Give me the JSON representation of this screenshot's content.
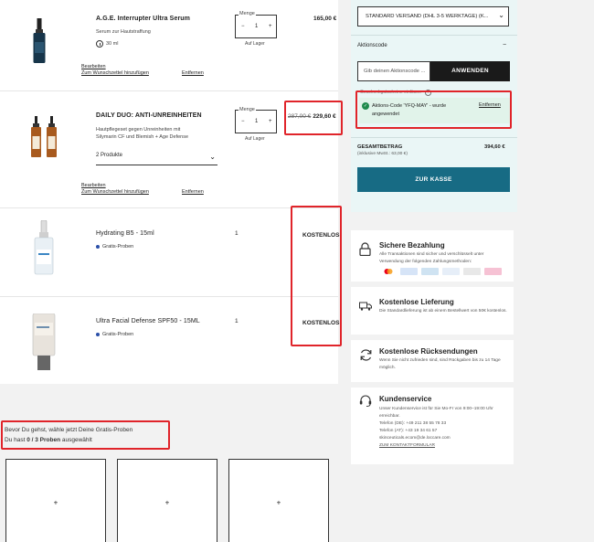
{
  "cart": {
    "items": [
      {
        "name": "A.G.E. Interrupter Ultra Serum",
        "description": "Serum zur Hautstraffung",
        "size": "30 ml",
        "qty_label": "Menge",
        "qty": "1",
        "stock": "Auf Lager",
        "price": "165,00 €",
        "edit": "Bearbeiten",
        "wishlist": "Zum Wunschzettel hinzufügen",
        "remove": "Entfernen"
      },
      {
        "name": "DAILY DUO: ANTI-UNREINHEITEN",
        "description_line1": "Hautpflegeset gegen Unreinheiten mit",
        "description_line2": "Silymarin CF und Blemish + Age Defense",
        "dropdown": "2 Produkte",
        "qty_label": "Menge",
        "qty": "1",
        "stock": "Auf Lager",
        "old_price": "287,00 €",
        "price": "229,60 €",
        "edit": "Bearbeiten",
        "wishlist": "Zum Wunschzettel hinzufügen",
        "remove": "Entfernen"
      },
      {
        "name": "Hydrating B5 - 15ml",
        "qty": "1",
        "tag": "Gratis-Proben",
        "price": "KOSTENLOS"
      },
      {
        "name": "Ultra Facial Defense SPF50 - 15ML",
        "qty": "1",
        "tag": "Gratis-Proben",
        "price": "KOSTENLOS"
      }
    ],
    "qty_minus": "−",
    "qty_plus": "+"
  },
  "gratis": {
    "line1": "Bevor Du gehst, wähle jetzt Deine Gratis-Proben",
    "line2_prefix": "Du hast ",
    "line2_count": "0 / 3 Proben",
    "line2_suffix": " ausgewählt",
    "slot_symbol": "+"
  },
  "summary": {
    "shipping": "STANDARD VERSAND (DHL 3-5 WERKTAGE) (K...",
    "promo_label": "Aktionscode",
    "promo_toggle": "−",
    "promo_placeholder": "Gib deinen Aktionscode ...",
    "apply": "ANWENDEN",
    "hint": "Geschenkgutscheine einlösen",
    "applied_msg": "Aktions-Code 'YFQ-MAY' - wurde angewendet",
    "applied_remove": "Entfernen",
    "total_label": "GESAMTBETRAG",
    "total_sub": "(inklusive MwSt.: 63,00 €)",
    "total_value": "394,60 €",
    "checkout": "ZUR KASSE"
  },
  "info": {
    "secure": {
      "title": "Sichere Bezahlung",
      "desc": "Alle Transaktionen sind sicher und verschlüsselt unter Verwendung der folgenden Zahlungsmethoden:"
    },
    "delivery": {
      "title": "Kostenlose Lieferung",
      "desc": "Die Standardlieferung ist ab einem Bestellwert von 50€ kostenlos."
    },
    "returns": {
      "title": "Kostenlose Rücksendungen",
      "desc": "Wenn Sie nicht zufrieden sind, sind Rückgaben bis zu 14 Tage möglich."
    },
    "service": {
      "title": "Kundenservice",
      "desc": "Unser Kundenservice ist für Sie Mo-Fr von 9:00–19:00 Uhr erreichbar.",
      "phone_de": "Telefon (DE): +49 211 38 55 78 33",
      "phone_at": "Telefon (AT): +43 19 34 61 57",
      "email": "skinceuticals.ecom@de.loccare.com",
      "form": "ZUM KONTAKTFORMULAR"
    }
  },
  "colors": {
    "accent_checkout": "#176b84",
    "highlight_red": "#e0242a",
    "success_green": "#1e8a4c",
    "summary_bg": "#eaf6f6"
  }
}
